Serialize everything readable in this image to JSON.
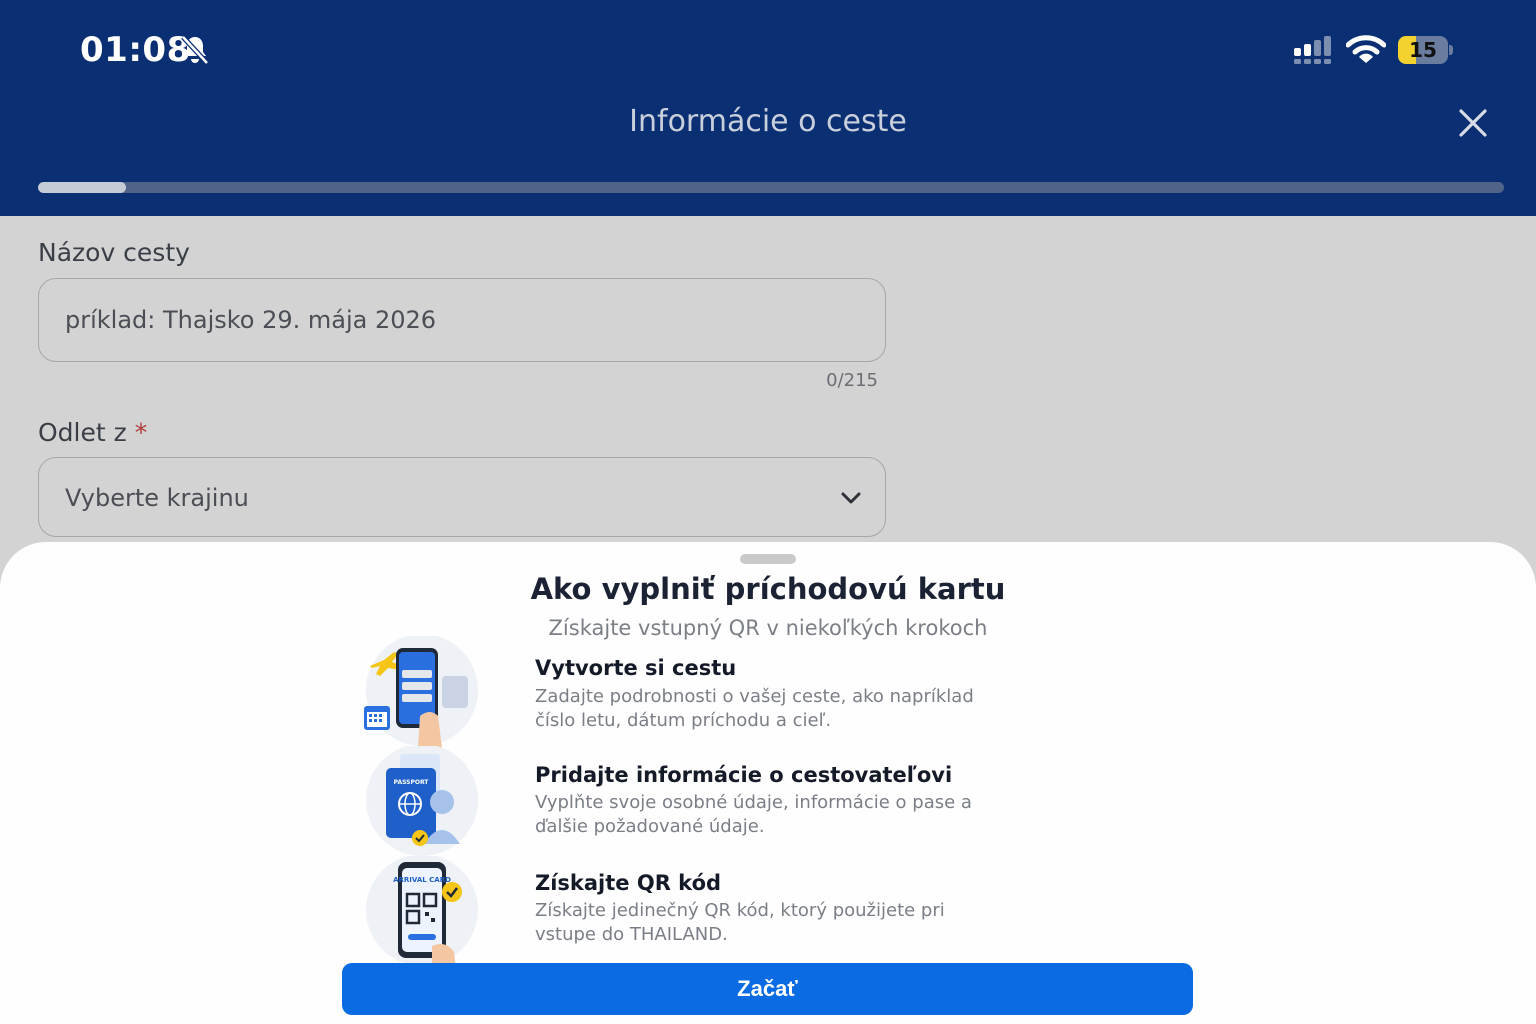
{
  "status_bar": {
    "time": "01:08",
    "battery_level": "15",
    "battery_fraction": 0.15,
    "icons": [
      "bell-off-icon",
      "cellular-signal-icon",
      "wifi-icon",
      "battery-icon"
    ]
  },
  "header": {
    "title": "Informácie o ceste",
    "close_icon": "close-icon",
    "progress_fraction": 0.06
  },
  "form": {
    "trip_name_label": "Názov cesty",
    "trip_name_placeholder": "príklad: Thajsko 29. mája 2026",
    "trip_name_counter": "0/215",
    "departure_label": "Odlet z",
    "required_marker": "*",
    "departure_placeholder": "Vyberte krajinu"
  },
  "sheet": {
    "title": "Ako vyplniť príchodovú kartu",
    "subtitle": "Získajte vstupný QR v niekoľkých krokoch",
    "steps": [
      {
        "title": "Vytvorte si cestu",
        "desc": "Zadajte podrobnosti o vašej ceste, ako napríklad číslo letu, dátum príchodu a cieľ.",
        "icon": "trip-phone-icon"
      },
      {
        "title": "Pridajte informácie o cestovateľovi",
        "desc": "Vyplňte svoje osobné údaje, informácie o pase a ďalšie požadované údaje.",
        "icon": "passport-icon",
        "icon_text": "PASSPORT"
      },
      {
        "title": "Získajte QR kód",
        "desc": "Získajte jedinečný QR kód, ktorý použijete pri vstupe do THAILAND.",
        "icon": "qr-code-phone-icon",
        "icon_text": "ARRIVAL CARD"
      }
    ],
    "start_button": "Začať"
  },
  "colors": {
    "header_bg": "#0a2f73",
    "primary_button": "#0a6be3",
    "required": "#b23a3a"
  }
}
